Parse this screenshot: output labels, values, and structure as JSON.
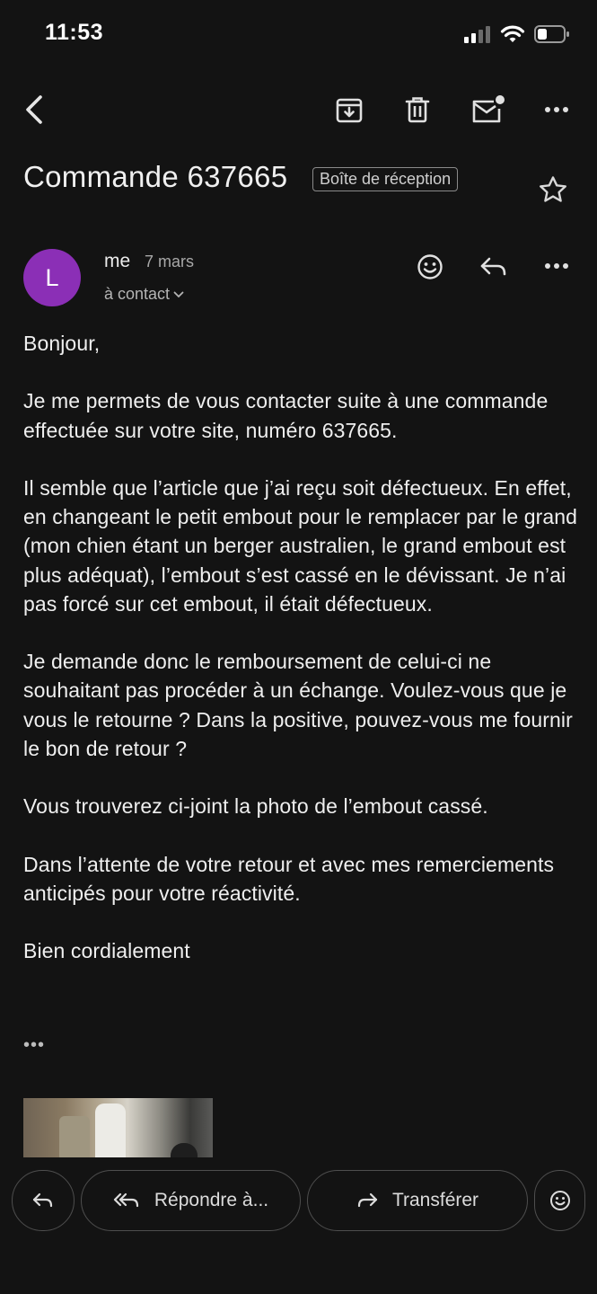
{
  "status_bar": {
    "time": "11:53"
  },
  "toolbar": {
    "back": "back-arrow-icon",
    "archive": "archive-icon",
    "delete": "trash-icon",
    "mark_unread": "mail-unread-icon",
    "more": "more-horizontal-icon"
  },
  "message": {
    "subject": "Commande 637665",
    "label": "Boîte de réception",
    "sender_initial": "L",
    "sender": "me",
    "date": "7 mars",
    "recipient": "à contact",
    "body": [
      "Bonjour,",
      "Je me permets de vous contacter suite à une commande effectuée sur votre site, numéro 637665.",
      "Il semble que l’article que j’ai reçu soit défectueux. En effet, en changeant le petit embout pour le remplacer par le grand (mon chien étant un berger australien, le grand embout est plus adéquat), l’embout s’est cassé en le dévissant. Je n’ai pas forcé sur cet embout, il était défectueux.",
      "Je demande donc le remboursement de celui-ci ne souhaitant pas procéder à un échange. Voulez-vous que je vous le retourne ? Dans la positive, pouvez-vous me fournir le bon de retour ?",
      "Vous trouverez ci-joint la photo de l’embout cassé.",
      "Dans l’attente de votre retour et avec mes remerciements anticipés pour votre réactivité.",
      "Bien cordialement"
    ],
    "trimmed": "•••"
  },
  "actions": {
    "reply_all": "Répondre à...",
    "forward": "Transférer"
  },
  "colors": {
    "background": "#131313",
    "avatar": "#8b2fb6",
    "text": "#efefef"
  }
}
